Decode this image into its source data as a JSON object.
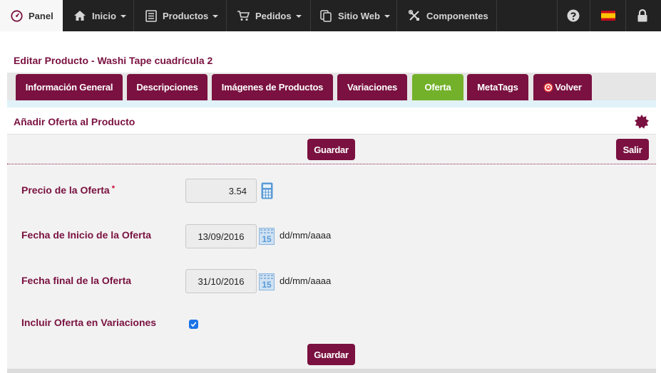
{
  "nav": {
    "panel": "Panel",
    "items": [
      {
        "label": "Inicio",
        "icon": "home-icon"
      },
      {
        "label": "Productos",
        "icon": "products-icon"
      },
      {
        "label": "Pedidos",
        "icon": "cart-icon"
      },
      {
        "label": "Sitio Web",
        "icon": "copy-icon"
      },
      {
        "label": "Componentes",
        "icon": "tools-icon"
      }
    ],
    "right_icons": [
      "help-icon",
      "spain-flag-icon",
      "lock-icon"
    ]
  },
  "page": {
    "title": "Editar Producto - Washi Tape cuadrícula 2"
  },
  "tabs": [
    {
      "label": "Información General"
    },
    {
      "label": "Descripciones"
    },
    {
      "label": "Imágenes de Productos"
    },
    {
      "label": "Variaciones"
    },
    {
      "label": "Oferta",
      "active": true
    },
    {
      "label": "MetaTags"
    },
    {
      "label": "Volver"
    }
  ],
  "section": {
    "title": "Añadir Oferta al Producto"
  },
  "toolbar": {
    "save_label": "Guardar",
    "exit_label": "Salir"
  },
  "form": {
    "price_label": "Precio de la Oferta",
    "price_required": "*",
    "price_value": "3.54",
    "start_label": "Fecha de Inicio de la Oferta",
    "start_value": "13/09/2016",
    "end_label": "Fecha final de la Oferta",
    "end_value": "31/10/2016",
    "date_format": "dd/mm/aaaa",
    "calendar_day": "15",
    "variations_label": "Incluir Oferta en Variaciones",
    "variations_checked": true,
    "save_label": "Guardar"
  },
  "colors": {
    "brand": "#7a1140",
    "active_tab": "#73b12a",
    "nav_bg": "#222222"
  }
}
